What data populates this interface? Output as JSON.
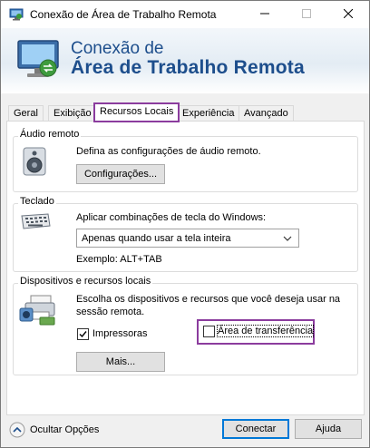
{
  "window": {
    "title": "Conexão de Área de Trabalho Remota",
    "controls": [
      "minimize-icon",
      "maximize-icon",
      "close-icon"
    ]
  },
  "banner": {
    "line1": "Conexão de",
    "line2": "Área de Trabalho Remota"
  },
  "tabs": [
    {
      "label": "Geral",
      "active": false
    },
    {
      "label": "Exibição",
      "active": false
    },
    {
      "label": "Recursos Locais",
      "active": true
    },
    {
      "label": "Experiência",
      "active": false
    },
    {
      "label": "Avançado",
      "active": false
    }
  ],
  "audio": {
    "group_label": "Áudio remoto",
    "description": "Defina as configurações de áudio remoto.",
    "button": "Configurações..."
  },
  "keyboard": {
    "group_label": "Teclado",
    "description": "Aplicar combinações de tecla do Windows:",
    "selected_option": "Apenas quando usar a tela inteira",
    "example": "Exemplo: ALT+TAB"
  },
  "devices": {
    "group_label": "Dispositivos e recursos locais",
    "description_line1": "Escolha os dispositivos e recursos que você deseja usar na",
    "description_line2": "sessão remota.",
    "printers_label": "Impressoras",
    "printers_checked": true,
    "clipboard_label": "Área de transferência",
    "clipboard_checked": false,
    "more_button": "Mais..."
  },
  "footer": {
    "hide_options": "Ocultar Opções",
    "connect": "Conectar",
    "help": "Ajuda"
  },
  "colors": {
    "banner_text": "#1d4e8c",
    "highlight": "#8b3c9e",
    "primary_border": "#0078d7"
  }
}
